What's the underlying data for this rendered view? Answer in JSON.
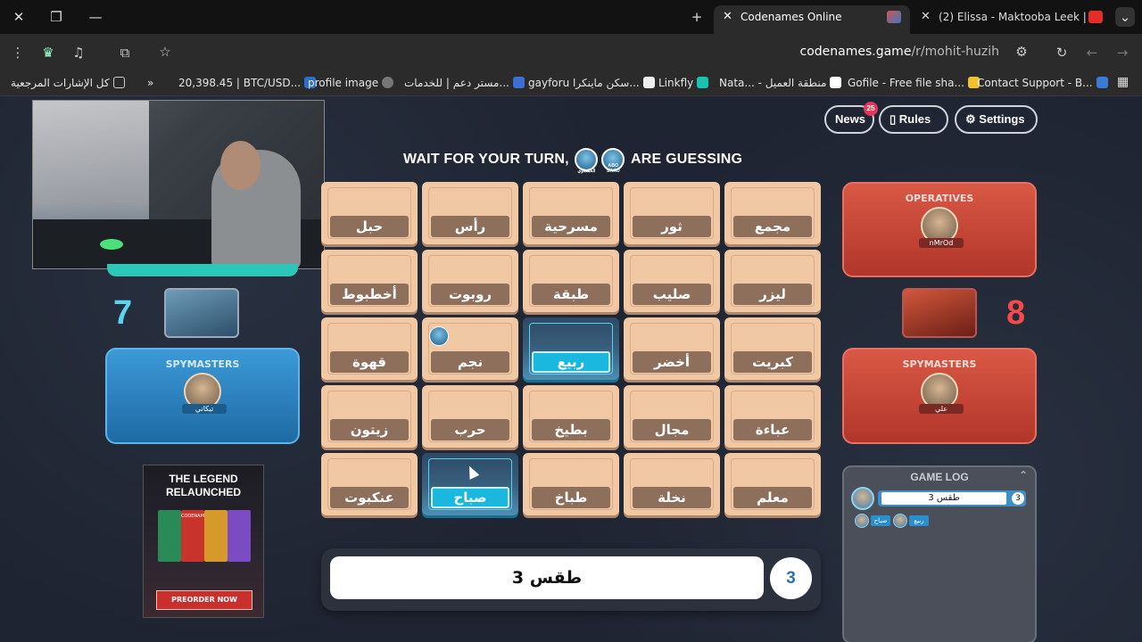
{
  "browser": {
    "tabs": [
      {
        "title": "Codenames Online",
        "active": true
      },
      {
        "title": "(2) Elissa - Maktooba Leek |",
        "active": false
      }
    ],
    "url_domain": "codenames.game",
    "url_path": "/r/mohit-huzih",
    "bookmarks": [
      "كل الإشارات المرجعية",
      "20,398.45 | BTC/USD...",
      "profile image",
      "مستر دعم | للخدمات...",
      "gayforu سكن ماينكرا...",
      "Linkfly",
      "Nata... - منطقة العميل",
      "Gofile - Free file sha...",
      "Contact Support - B..."
    ]
  },
  "game": {
    "status": {
      "prefix": "WAIT FOR YOUR TURN,",
      "suffix": "ARE GUESSING",
      "guesser_labels": [
        "الحسناوي",
        "ABO SAAD"
      ]
    },
    "top_buttons": {
      "news": "News",
      "news_badge": "25",
      "rules": "Rules",
      "settings": "Settings"
    },
    "blue_team": {
      "score": "7",
      "spymasters_title": "SPYMASTERS",
      "spymaster": "تيكاني"
    },
    "red_team": {
      "score": "8",
      "operatives_title": "OPERATIVES",
      "operative": "nMrOd",
      "spymasters_title": "SPYMASTERS",
      "spymaster": "علي"
    },
    "cards": [
      "حبل",
      "رأس",
      "مسرحية",
      "ثور",
      "مجمع",
      "أخطبوط",
      "روبوت",
      "طبقة",
      "صليب",
      "ليزر",
      "قهوة",
      "نجم",
      "ربيع",
      "أخضر",
      "كبريت",
      "زيتون",
      "حرب",
      "بطيخ",
      "مجال",
      "عباءة",
      "عنكبوت",
      "صباح",
      "طباخ",
      "نخلة",
      "معلم"
    ],
    "card_tag_label": "ABO SAAD",
    "clue": {
      "word": "طقس 3",
      "number": "3"
    },
    "game_log": {
      "title": "GAME LOG",
      "entry_player": "تيكاني",
      "entry_clue": "طقس 3",
      "entry_number": "3",
      "guesses": [
        "صباح",
        "ربيع"
      ]
    },
    "ad": {
      "headline": "THE LEGEND RELAUNCHED",
      "cta": "PREORDER NOW",
      "brand": "CODENAMES"
    }
  }
}
